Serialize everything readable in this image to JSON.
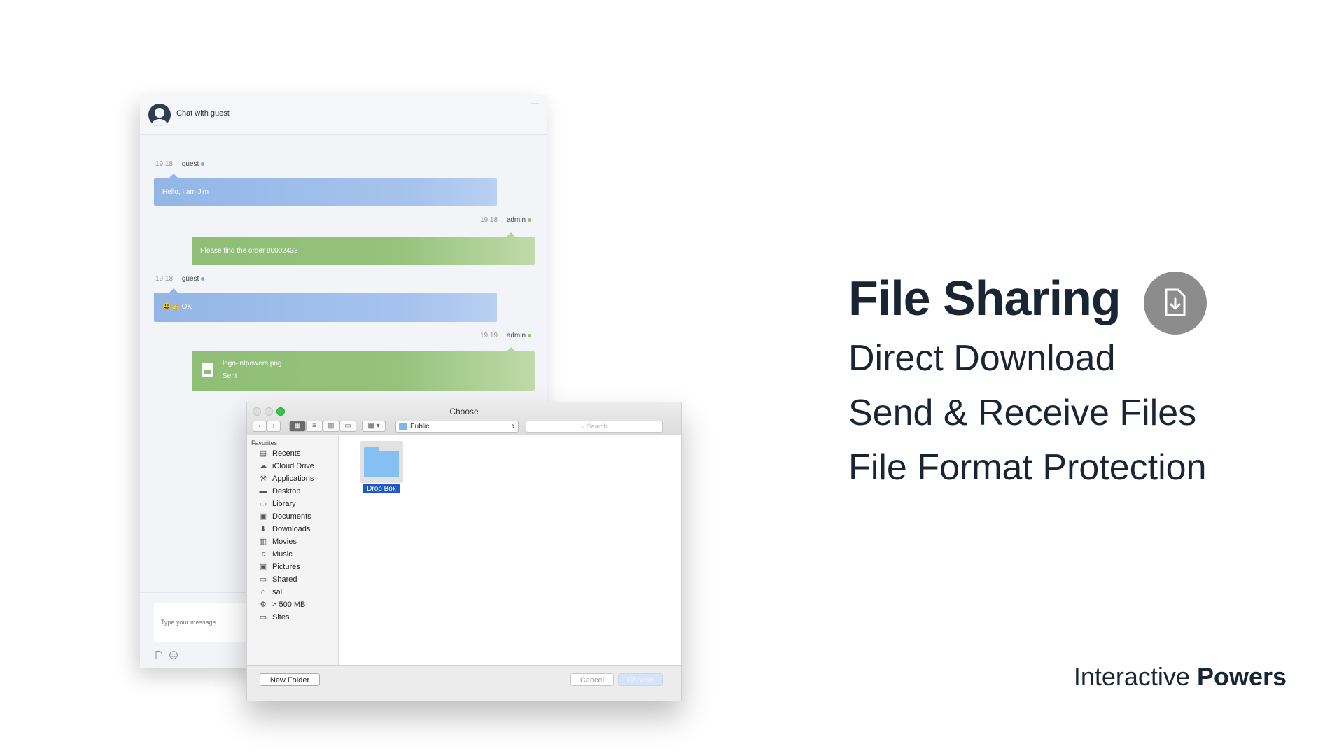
{
  "chat": {
    "title": "Chat with guest",
    "minimize": "—",
    "messages": [
      {
        "time": "19:18",
        "user": "guest",
        "text": "Hello, I am Jim"
      },
      {
        "time": "19:18",
        "user": "admin",
        "text": "Please find the order 90002433"
      },
      {
        "time": "19:18",
        "user": "guest",
        "text": "😃👍 OK"
      },
      {
        "time": "19:19",
        "user": "admin",
        "file_name": "logo-intpowers.png",
        "status": "Sent"
      }
    ],
    "input_placeholder": "Type your message"
  },
  "dialog": {
    "title": "Choose",
    "location": "Public",
    "search_placeholder": "Search",
    "favorites_header": "Favorites",
    "sidebar_items": [
      {
        "label": "Recents",
        "icon": "recents-icon"
      },
      {
        "label": "iCloud Drive",
        "icon": "cloud-icon"
      },
      {
        "label": "Applications",
        "icon": "applications-icon"
      },
      {
        "label": "Desktop",
        "icon": "desktop-icon"
      },
      {
        "label": "Library",
        "icon": "folder-icon"
      },
      {
        "label": "Documents",
        "icon": "documents-icon"
      },
      {
        "label": "Downloads",
        "icon": "downloads-icon"
      },
      {
        "label": "Movies",
        "icon": "movies-icon"
      },
      {
        "label": "Music",
        "icon": "music-icon"
      },
      {
        "label": "Pictures",
        "icon": "pictures-icon"
      },
      {
        "label": "Shared",
        "icon": "folder-icon"
      },
      {
        "label": "sal",
        "icon": "home-icon"
      },
      {
        "label": "> 500 MB",
        "icon": "gear-icon"
      },
      {
        "label": "Sites",
        "icon": "folder-icon"
      }
    ],
    "folder_label": "Drop Box",
    "new_folder": "New Folder",
    "cancel": "Cancel",
    "choose": "Choose"
  },
  "features": {
    "title": "File Sharing",
    "lines": [
      "Direct Download",
      "Send & Receive Files",
      "File Format Protection"
    ]
  },
  "brand": {
    "light": "Interactive",
    "bold": "Powers"
  },
  "colors": {
    "guest_bubble": "#93b6e6",
    "admin_bubble": "#8fbe76",
    "heading": "#1a2533",
    "selection": "#1e58c8"
  }
}
